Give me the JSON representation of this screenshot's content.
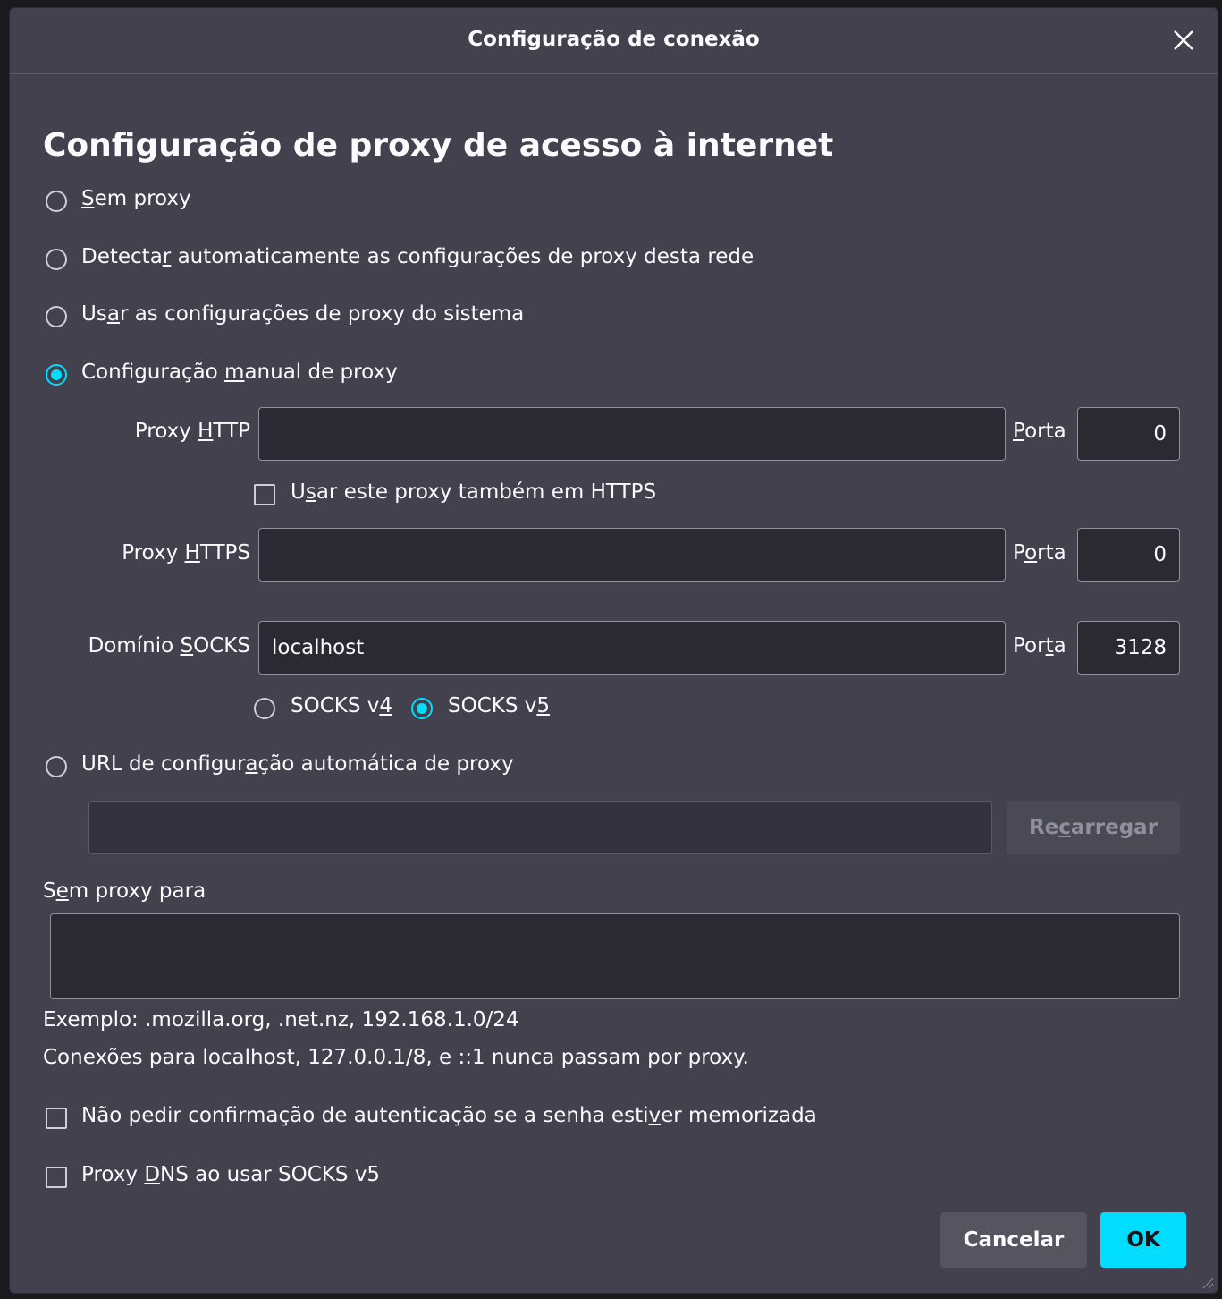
{
  "window": {
    "title": "Configuração de conexão"
  },
  "heading": "Configuração de proxy de acesso à internet",
  "proxy_mode": {
    "no_proxy": {
      "pre": "",
      "key": "S",
      "post": "em proxy",
      "checked": false
    },
    "auto_detect": {
      "pre": "Detecta",
      "key": "r",
      "post": " automaticamente as configurações de proxy desta rede",
      "checked": false
    },
    "system": {
      "pre": "Us",
      "key": "a",
      "post": "r as configurações de proxy do sistema",
      "checked": false
    },
    "manual": {
      "pre": "Configuração ",
      "key": "m",
      "post": "anual de proxy",
      "checked": true
    },
    "auto_url": {
      "pre": "URL de configur",
      "key": "a",
      "post": "ção automática de proxy",
      "checked": false
    }
  },
  "http_proxy": {
    "label_pre": "Proxy ",
    "label_key": "H",
    "label_post": "TTP",
    "value": "",
    "port_label_pre": "",
    "port_label_key": "P",
    "port_label_post": "orta",
    "port": "0"
  },
  "use_for_https": {
    "label_pre": "U",
    "label_key": "s",
    "label_post": "ar este proxy também em HTTPS",
    "checked": false
  },
  "https_proxy": {
    "label_pre": "Proxy ",
    "label_key": "H",
    "label_post": "TTPS",
    "value": "",
    "port_label_pre": "P",
    "port_label_key": "o",
    "port_label_post": "rta",
    "port": "0"
  },
  "socks_proxy": {
    "label_pre": "Domínio ",
    "label_key": "S",
    "label_post": "OCKS",
    "value": "localhost",
    "port_label_pre": "Por",
    "port_label_key": "t",
    "port_label_post": "a",
    "port": "3128"
  },
  "socks_version": {
    "v4": {
      "pre": "SOCKS v",
      "key": "4",
      "checked": false
    },
    "v5": {
      "pre": "SOCKS v",
      "key": "5",
      "checked": true
    }
  },
  "auto_url_field": {
    "value": "",
    "reload_pre": "Re",
    "reload_key": "c",
    "reload_post": "arregar"
  },
  "no_proxy_for": {
    "label_pre": "S",
    "label_key": "e",
    "label_post": "m proxy para",
    "value": "",
    "example": "Exemplo: .mozilla.org, .net.nz, 192.168.1.0/24",
    "note": "Conexões para localhost, 127.0.0.1/8, e ::1 nunca passam por proxy."
  },
  "auth_prompt": {
    "pre": "Não pedir confirmação de autenticação se a senha esti",
    "key": "v",
    "post": "er memorizada",
    "checked": false
  },
  "proxy_dns": {
    "pre": "Proxy ",
    "key": "D",
    "post": "NS ao usar SOCKS v5",
    "checked": false
  },
  "buttons": {
    "cancel": "Cancelar",
    "ok": "OK"
  },
  "colors": {
    "accent": "#00ddff",
    "background": "#42414d",
    "input_bg": "#2b2a33"
  }
}
